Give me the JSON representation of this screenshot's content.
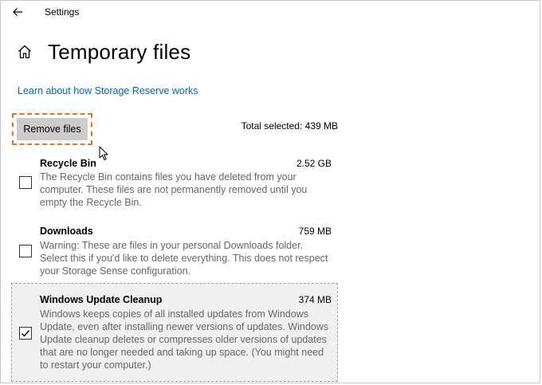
{
  "app": {
    "title": "Settings"
  },
  "page": {
    "title": "Temporary files"
  },
  "links": {
    "learn": "Learn about how Storage Reserve works"
  },
  "actions": {
    "remove_label": "Remove files"
  },
  "summary": {
    "total_selected": "Total selected: 439 MB"
  },
  "items": [
    {
      "name": "Recycle Bin",
      "size": "2.52 GB",
      "checked": false,
      "description": "The Recycle Bin contains files you have deleted from your computer. These files are not permanently removed until you empty the Recycle Bin."
    },
    {
      "name": "Downloads",
      "size": "759 MB",
      "checked": false,
      "description": "Warning: These are files in your personal Downloads folder. Select this if you'd like to delete everything. This does not respect your Storage Sense configuration."
    },
    {
      "name": "Windows Update Cleanup",
      "size": "374 MB",
      "checked": true,
      "description": "Windows keeps copies of all installed updates from Windows Update, even after installing newer versions of updates. Windows Update cleanup deletes or compresses older versions of updates that are no longer needed and taking up space. (You might need to restart your computer.)"
    }
  ],
  "colors": {
    "link": "#0067b8",
    "focus_outline": "#e8741b",
    "button_bg": "#cccccc",
    "description_text": "#666666",
    "selected_item_bg": "#f0f0f0"
  }
}
